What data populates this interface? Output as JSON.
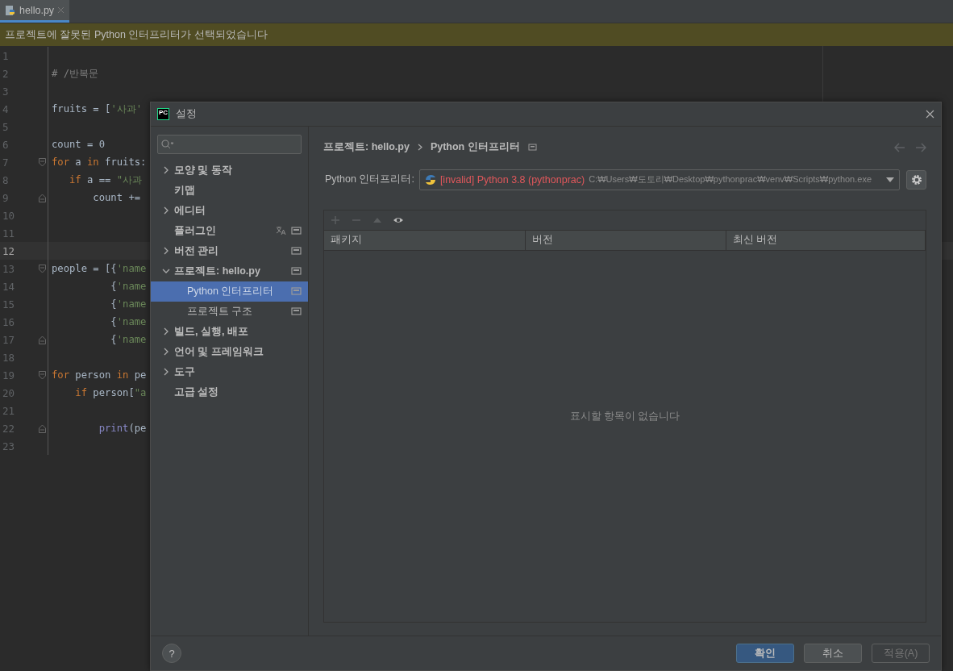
{
  "tabs": [
    {
      "label": "hello.py",
      "selected": true
    }
  ],
  "banner": {
    "text": "프로젝트에 잘못된 Python 인터프리터가 선택되었습니다"
  },
  "editor": {
    "lines": [
      {
        "number": "1",
        "current": false
      },
      {
        "number": "2",
        "current": false,
        "tokens": [
          {
            "kind": "comment",
            "text": "# /반복문"
          }
        ]
      },
      {
        "number": "3",
        "current": false
      },
      {
        "number": "4",
        "current": false,
        "tokens": [
          {
            "kind": "plain",
            "text": "fruits = ["
          },
          {
            "kind": "string",
            "text": "'사과'"
          }
        ]
      },
      {
        "number": "5",
        "current": false
      },
      {
        "number": "6",
        "current": false,
        "tokens": [
          {
            "kind": "plain",
            "text": "count = 0"
          }
        ]
      },
      {
        "number": "7",
        "current": false,
        "fold_start": true,
        "tokens": [
          {
            "kind": "keyword",
            "text": "for"
          },
          {
            "kind": "plain",
            "text": " a "
          },
          {
            "kind": "keyword",
            "text": "in"
          },
          {
            "kind": "plain",
            "text": " fruits:"
          }
        ]
      },
      {
        "number": "8",
        "current": false,
        "tokens": [
          {
            "kind": "keyword",
            "text": "   if"
          },
          {
            "kind": "plain",
            "text": " a == "
          },
          {
            "kind": "string",
            "text": "\"사과"
          }
        ]
      },
      {
        "number": "9",
        "current": false,
        "fold_end": true,
        "tokens": [
          {
            "kind": "plain",
            "text": "       count +="
          }
        ]
      },
      {
        "number": "10",
        "current": false
      },
      {
        "number": "11",
        "current": false
      },
      {
        "number": "12",
        "current": true
      },
      {
        "number": "13",
        "current": false,
        "fold_start": true,
        "tokens": [
          {
            "kind": "plain",
            "text": "people = [{"
          },
          {
            "kind": "string",
            "text": "'name"
          }
        ]
      },
      {
        "number": "14",
        "current": false,
        "tokens": [
          {
            "kind": "plain",
            "text": "          {"
          },
          {
            "kind": "string",
            "text": "'name"
          }
        ]
      },
      {
        "number": "15",
        "current": false,
        "tokens": [
          {
            "kind": "plain",
            "text": "          {"
          },
          {
            "kind": "string",
            "text": "'name"
          }
        ]
      },
      {
        "number": "16",
        "current": false,
        "tokens": [
          {
            "kind": "plain",
            "text": "          {"
          },
          {
            "kind": "string",
            "text": "'name"
          }
        ]
      },
      {
        "number": "17",
        "current": false,
        "fold_end": true,
        "tokens": [
          {
            "kind": "plain",
            "text": "          {"
          },
          {
            "kind": "string",
            "text": "'name"
          }
        ]
      },
      {
        "number": "18",
        "current": false
      },
      {
        "number": "19",
        "current": false,
        "fold_start": true,
        "tokens": [
          {
            "kind": "keyword",
            "text": "for"
          },
          {
            "kind": "plain",
            "text": " person "
          },
          {
            "kind": "keyword",
            "text": "in"
          },
          {
            "kind": "plain",
            "text": " pe"
          }
        ]
      },
      {
        "number": "20",
        "current": false,
        "tokens": [
          {
            "kind": "keyword",
            "text": "    if"
          },
          {
            "kind": "plain",
            "text": " person["
          },
          {
            "kind": "string",
            "text": "\"a"
          }
        ]
      },
      {
        "number": "21",
        "current": false
      },
      {
        "number": "22",
        "current": false,
        "fold_end": true,
        "tokens": [
          {
            "kind": "builtin",
            "text": "        print"
          },
          {
            "kind": "plain",
            "text": "(pe"
          }
        ]
      },
      {
        "number": "23",
        "current": false
      }
    ]
  },
  "dialog": {
    "logo": "PC",
    "title": "설정",
    "sidebar": {
      "items": [
        {
          "label": "모양 및 동작",
          "expanded": false,
          "selected": false,
          "translate_icon": false,
          "project_icon": false
        },
        {
          "label": "키맵",
          "selected": false,
          "translate_icon": false,
          "project_icon": false
        },
        {
          "label": "에디터",
          "expanded": false,
          "selected": false,
          "translate_icon": false,
          "project_icon": false
        },
        {
          "label": "플러그인",
          "selected": false,
          "translate_icon": true,
          "project_icon": true
        },
        {
          "label": "버전 관리",
          "expanded": false,
          "selected": false,
          "translate_icon": false,
          "project_icon": true
        },
        {
          "label": "프로젝트: hello.py",
          "expanded": true,
          "selected": false,
          "translate_icon": false,
          "project_icon": true,
          "children": [
            {
              "label": "Python 인터프리터",
              "selected": true,
              "translate_icon": false,
              "project_icon": true
            },
            {
              "label": "프로젝트 구조",
              "selected": false,
              "translate_icon": false,
              "project_icon": true
            }
          ]
        },
        {
          "label": "빌드, 실행, 배포",
          "expanded": false,
          "selected": false,
          "translate_icon": false,
          "project_icon": false
        },
        {
          "label": "언어 및 프레임워크",
          "expanded": false,
          "selected": false,
          "translate_icon": false,
          "project_icon": false
        },
        {
          "label": "도구",
          "expanded": false,
          "selected": false,
          "translate_icon": false,
          "project_icon": false
        },
        {
          "label": "고급 설정",
          "selected": false,
          "translate_icon": false,
          "project_icon": false
        }
      ]
    },
    "breadcrumb": [
      "프로젝트: hello.py",
      "Python 인터프리터"
    ],
    "interpreter": {
      "label": "Python 인터프리터:",
      "status": "[invalid]",
      "name": "Python 3.8 (pythonprac)",
      "path": "C:₩Users₩도토리₩Desktop₩pythonprac₩venv₩Scripts₩python.exe"
    },
    "packages": {
      "toolbar": [
        {
          "kind": "add",
          "disabled": true
        },
        {
          "kind": "remove",
          "disabled": true
        },
        {
          "kind": "upgrade",
          "disabled": true
        },
        {
          "kind": "show",
          "disabled": false
        }
      ],
      "columns": [
        "패키지",
        "버전",
        "최신 버전"
      ],
      "empty_text": "표시할 항목이 없습니다"
    },
    "help": "?",
    "buttons": [
      {
        "label": "확인",
        "kind": "primary",
        "disabled": false
      },
      {
        "label": "취소",
        "kind": "normal",
        "disabled": false
      },
      {
        "label": "적용(A)",
        "kind": "normal",
        "disabled": true
      }
    ]
  }
}
